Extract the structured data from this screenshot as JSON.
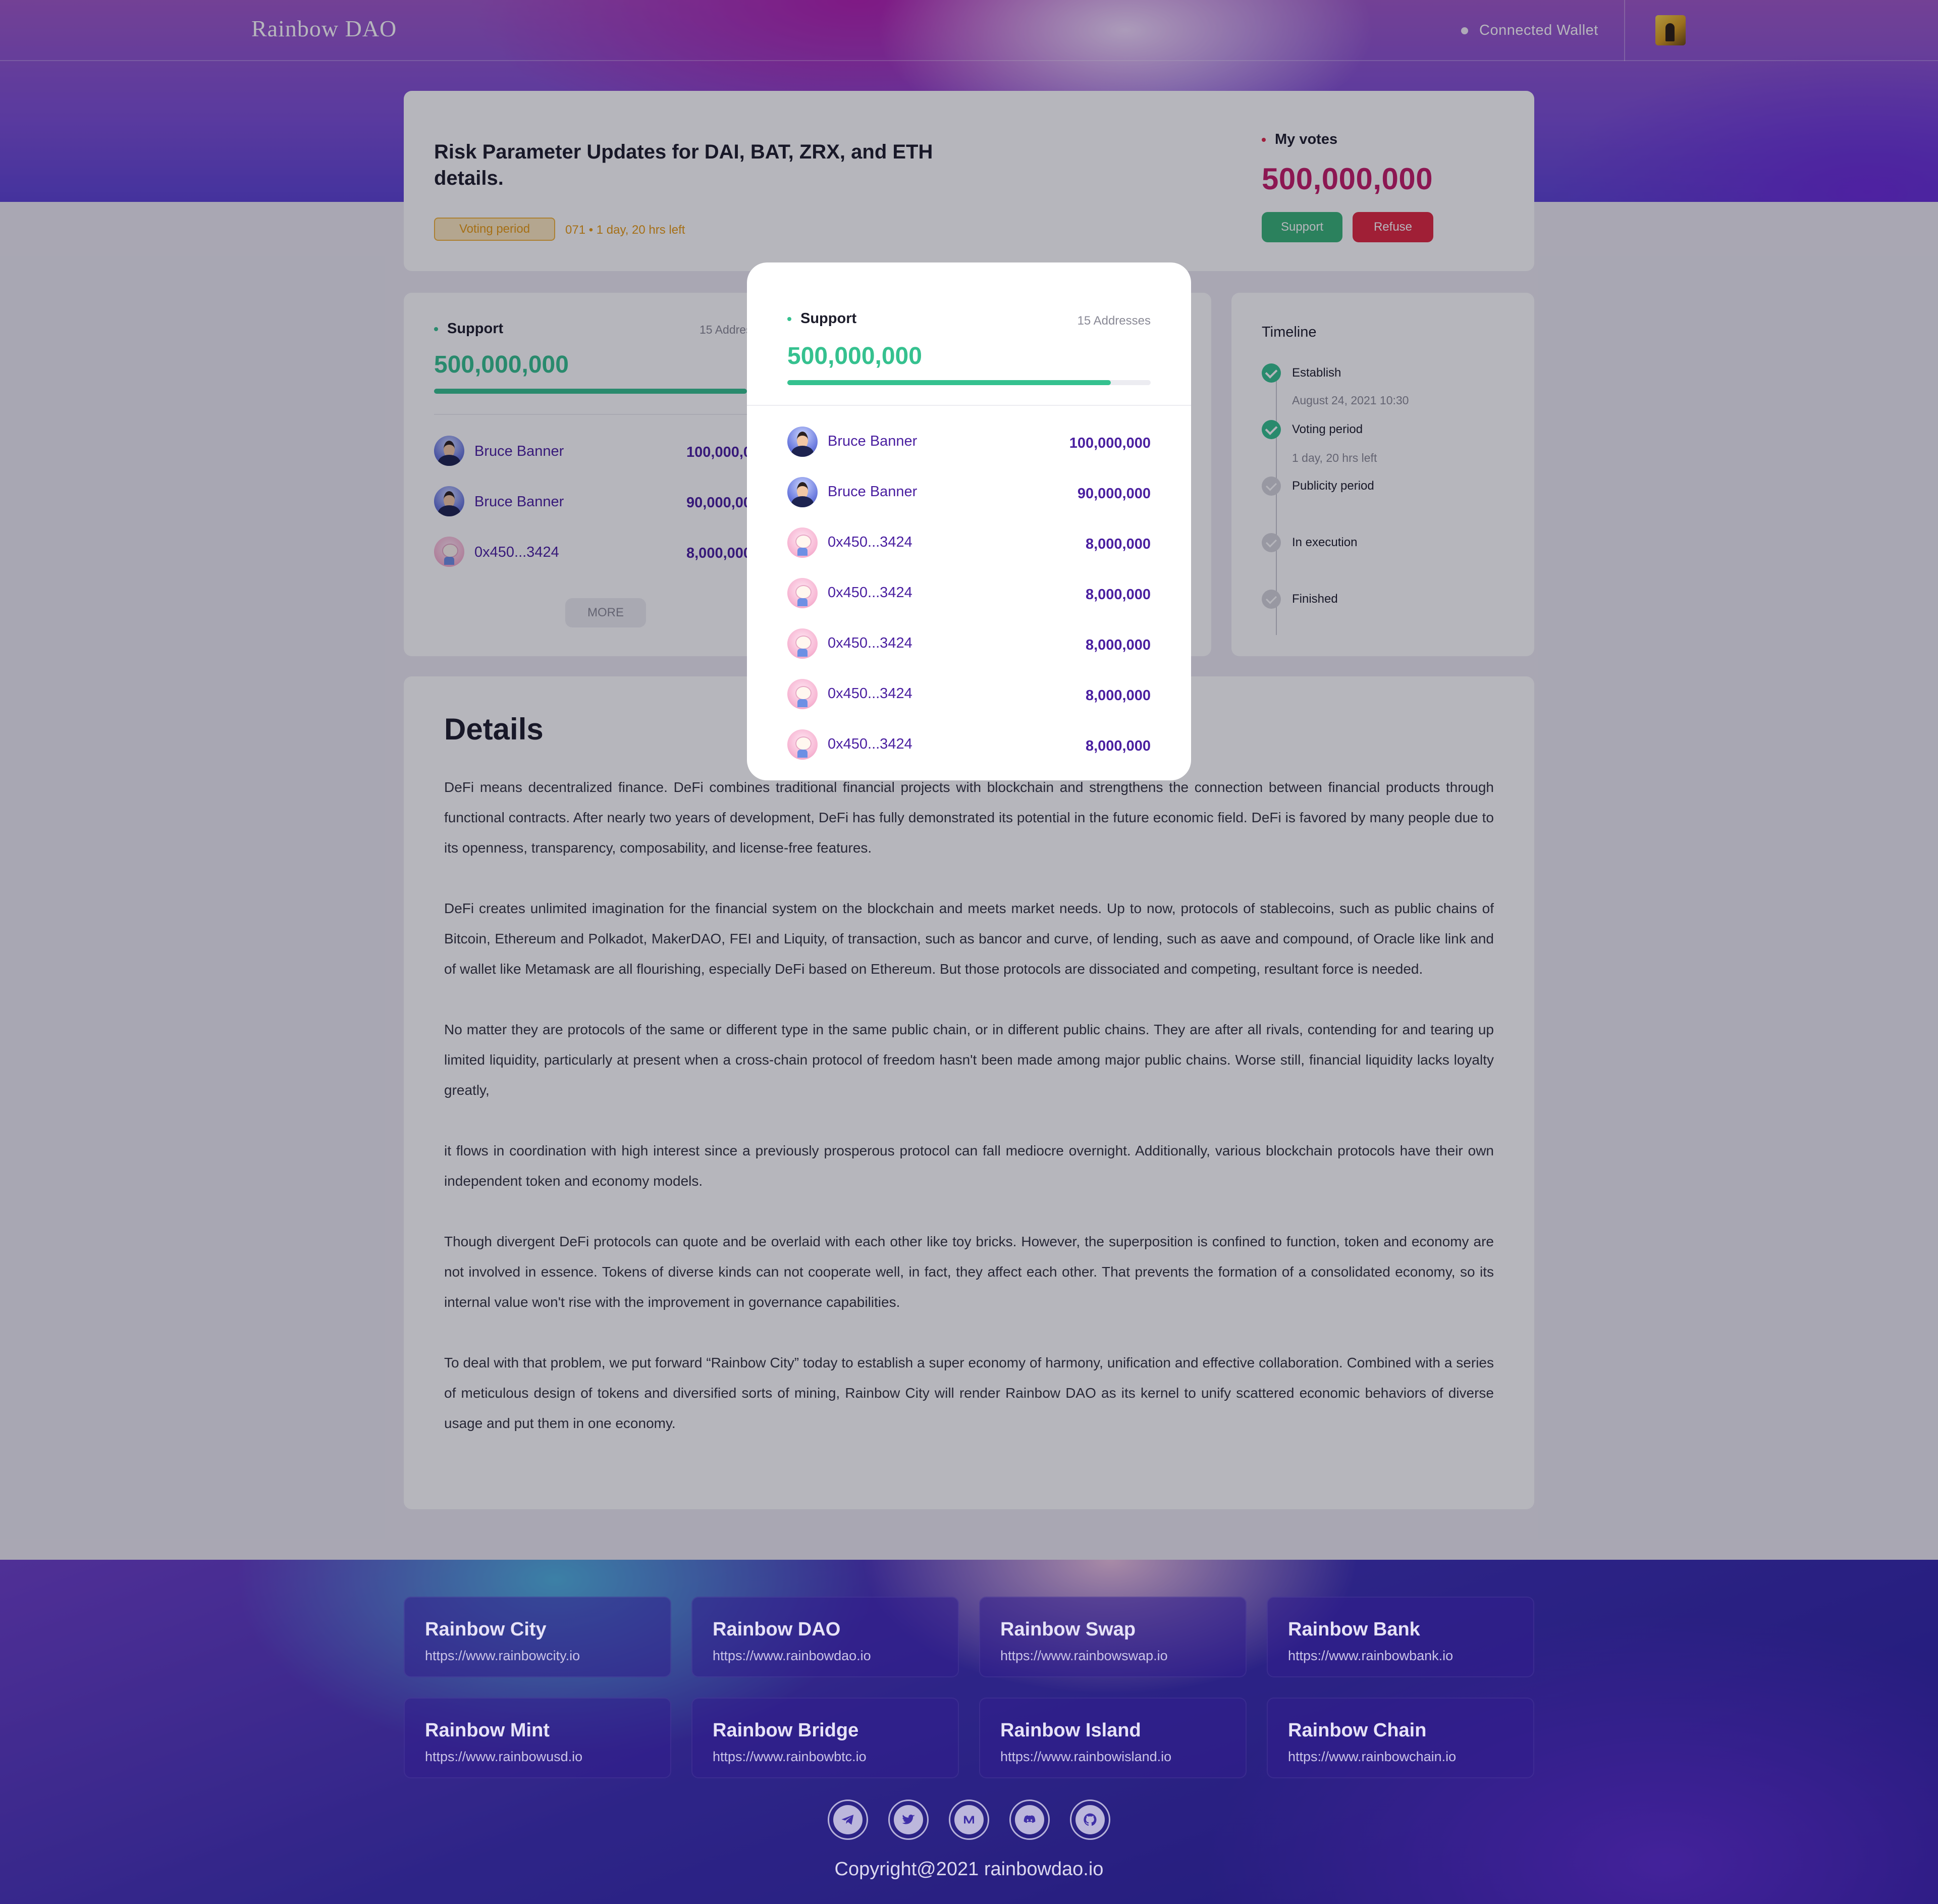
{
  "header": {
    "logo": "Rainbow DAO",
    "wallet_status": "Connected  Wallet"
  },
  "proposal": {
    "title": "Risk Parameter Updates for DAI, BAT, ZRX, and ETH details.",
    "status": "Voting period",
    "meta": "071 • 1 day, 20 hrs left",
    "my_votes_label": "My votes",
    "my_votes_value": "500,000,000",
    "support_button": "Support",
    "refuse_button": "Refuse"
  },
  "support": {
    "label": "Support",
    "address_count": "15 Addresses",
    "total": "500,000,000",
    "progress": 0.89,
    "more_button": "MORE",
    "voters": [
      {
        "name": "Bruce Banner",
        "amount": "100,000,000",
        "avatar": "person-avatar"
      },
      {
        "name": "Bruce Banner",
        "amount": "90,000,000",
        "avatar": "person-avatar"
      },
      {
        "name": "0x450...3424",
        "amount": "8,000,000",
        "avatar": "toy-avatar"
      },
      {
        "name": "0x450...3424",
        "amount": "8,000,000",
        "avatar": "toy-avatar"
      },
      {
        "name": "0x450...3424",
        "amount": "8,000,000",
        "avatar": "toy-avatar"
      },
      {
        "name": "0x450...3424",
        "amount": "8,000,000",
        "avatar": "toy-avatar"
      },
      {
        "name": "0x450...3424",
        "amount": "8,000,000",
        "avatar": "toy-avatar"
      }
    ]
  },
  "timeline": {
    "title": "Timeline",
    "steps": [
      {
        "label": "Establish",
        "sub": "August 24, 2021  10:30",
        "done": true
      },
      {
        "label": "Voting period",
        "sub": "1 day, 20 hrs left",
        "done": true
      },
      {
        "label": "Publicity period",
        "sub": "",
        "done": false
      },
      {
        "label": "In execution",
        "sub": "",
        "done": false
      },
      {
        "label": "Finished",
        "sub": "",
        "done": false
      }
    ]
  },
  "details": {
    "title": "Details",
    "paragraphs": [
      "DeFi means decentralized finance. DeFi combines traditional financial projects with blockchain and strengthens the connection between financial products through functional contracts. After nearly two years of development, DeFi has fully demonstrated its potential in the future economic field. DeFi is favored by many people due to its openness, transparency, composability, and license-free features.",
      "DeFi creates unlimited imagination for the financial system on the blockchain and meets market needs. Up to now, protocols of stablecoins, such as public chains of Bitcoin, Ethereum and Polkadot, MakerDAO, FEI and Liquity, of transaction, such as bancor and curve, of lending, such as aave and compound, of Oracle like link and of wallet like Metamask are all flourishing, especially DeFi based on Ethereum. But those protocols are dissociated and competing, resultant force is needed.",
      "No matter they are protocols of the same or different type in the same public chain, or in different public chains. They are after all rivals, contending for and tearing up limited liquidity, particularly at present when a cross-chain protocol of freedom hasn't been made among major public chains. Worse still, financial liquidity lacks loyalty greatly,",
      "it flows in coordination with high interest since a previously prosperous protocol can fall mediocre overnight. Additionally, various blockchain protocols have their own independent token and economy models.",
      "Though divergent DeFi protocols can quote and be overlaid with each other like toy bricks. However, the superposition is confined to function, token and economy are not involved in essence. Tokens of diverse kinds can not cooperate well, in fact, they affect each other. That prevents the formation of a consolidated economy, so its internal value won't rise with the improvement in governance capabilities.",
      "To deal with that problem, we put forward “Rainbow City” today to establish a super economy of harmony, unification and effective collaboration. Combined with a series of meticulous design of tokens and diversified sorts of mining, Rainbow City will render Rainbow DAO as its kernel to unify scattered economic behaviors of diverse usage and put them in one economy."
    ]
  },
  "footer": {
    "projects": [
      {
        "name": "Rainbow City",
        "url": "https://www.rainbowcity.io"
      },
      {
        "name": "Rainbow DAO",
        "url": "https://www.rainbowdao.io"
      },
      {
        "name": "Rainbow Swap",
        "url": "https://www.rainbowswap.io"
      },
      {
        "name": "Rainbow Bank",
        "url": "https://www.rainbowbank.io"
      },
      {
        "name": "Rainbow Mint",
        "url": "https://www.rainbowusd.io"
      },
      {
        "name": "Rainbow Bridge",
        "url": "https://www.rainbowbtc.io"
      },
      {
        "name": "Rainbow Island",
        "url": "https://www.rainbowisland.io"
      },
      {
        "name": "Rainbow Chain",
        "url": "https://www.rainbowchain.io"
      }
    ],
    "social_icons": [
      "telegram-icon",
      "twitter-icon",
      "medium-icon",
      "discord-icon",
      "github-icon"
    ],
    "copyright": "Copyright@2021 rainbowdao.io"
  },
  "colors": {
    "accent_green": "#35c18f",
    "accent_red": "#e0283f",
    "votes_magenta": "#c31c68",
    "voter_purple": "#4a1fa0",
    "status_orange": "#e79a12"
  }
}
